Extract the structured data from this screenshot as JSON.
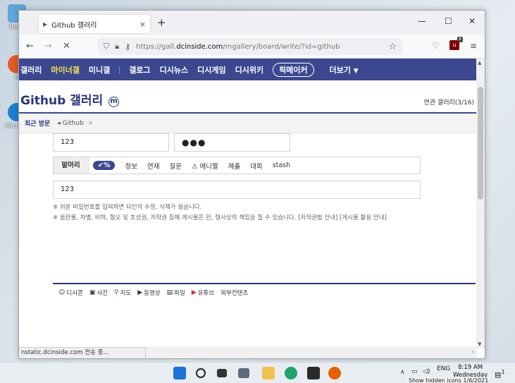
{
  "desktop": {
    "icons": [
      {
        "label": "Recy",
        "color": "#5fa8d8"
      },
      {
        "label": "Fi",
        "color": "#e25a2b"
      },
      {
        "label": "Micr Ed",
        "color": "#1f7fd1"
      }
    ]
  },
  "browser": {
    "tab": {
      "title": "Github 갤러리",
      "close": "×"
    },
    "new_tab": "+",
    "window_controls": {
      "minimize": "—",
      "maximize": "☐",
      "close": "✕"
    },
    "nav": {
      "back": "←",
      "forward": "→",
      "stop": "✕"
    },
    "url": {
      "prefix": "https://gall.",
      "domain": "dcinside.com",
      "path": "/mgallery/board/write/?id=github"
    },
    "ublock_badge": "8",
    "status": "nstatic.dcinside.com 전송 중..."
  },
  "site": {
    "gnb": {
      "items": [
        "갤러리",
        "마이너갤",
        "미니갤",
        "갤로그",
        "디시뉴스",
        "디시게임",
        "디시위키",
        "픽메이커",
        "더보기"
      ],
      "more_arrow": "▼"
    },
    "gallery": {
      "title": "Github 갤러리",
      "badge": "m",
      "related": "연관 갤러리(3/16)"
    },
    "recent": {
      "label": "최근 방문",
      "item": "Github",
      "close": "×"
    },
    "form": {
      "nickname": "123",
      "password": "●●●",
      "subject_first": "말머리",
      "subject_selected": "✔%",
      "subjects": [
        "정보",
        "연재",
        "질문",
        "⚠ 애니짤",
        "제출",
        "대회",
        "stash"
      ],
      "title_value": "123",
      "notice1": "※ 쉬운 비밀번호를 입력하면 타인의 수정, 삭제가 쉽습니다.",
      "notice2": "※ 음란물, 차별, 비하, 혐오 및 초상권, 저작권 침해 게시물은 민, 형사상의 책임을 질 수 있습니다. [저작권법 안내] [게시물 활용 안내]"
    },
    "editor_toolbar": [
      {
        "icon": "☺",
        "label": "디시콘"
      },
      {
        "icon": "▣",
        "label": "사진"
      },
      {
        "icon": "⚲",
        "label": "지도"
      },
      {
        "icon": "▶",
        "label": "동영상"
      },
      {
        "icon": "▤",
        "label": "파일"
      },
      {
        "icon": "▶",
        "label": "유튜브"
      },
      {
        "icon": "",
        "label": "외부컨텐츠"
      }
    ]
  },
  "taskbar": {
    "lang": "ENG",
    "time": "8:19 AM",
    "day": "Wednesday",
    "date": "1/6/2021",
    "hidden_tip": "Show hidden icons",
    "notif_count": "1"
  }
}
